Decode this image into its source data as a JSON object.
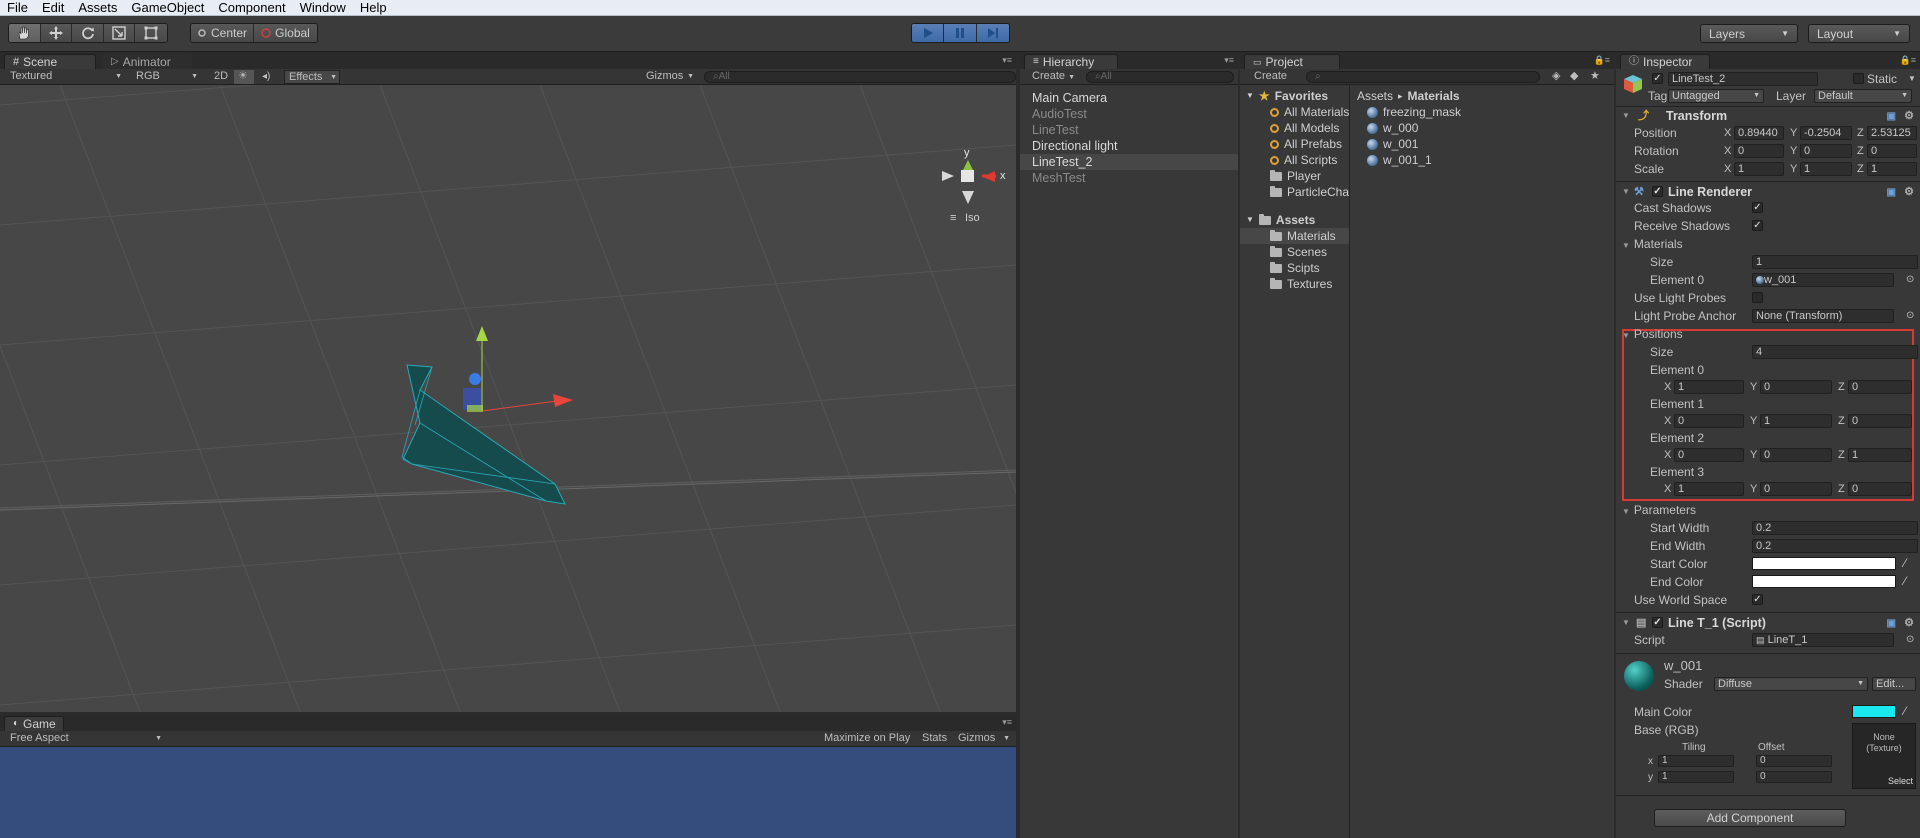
{
  "menu": [
    "File",
    "Edit",
    "Assets",
    "GameObject",
    "Component",
    "Window",
    "Help"
  ],
  "toolbar": {
    "pivot": "Center",
    "space": "Global",
    "layers": "Layers",
    "layout": "Layout"
  },
  "scene": {
    "tabs": [
      "Scene",
      "Animator"
    ],
    "shading": "Textured",
    "render_mode": "RGB",
    "mode_2d": "2D",
    "effects": "Effects",
    "gizmos": "Gizmos",
    "search": "All",
    "gizmo_y": "y",
    "gizmo_x": "x",
    "projection": "Iso"
  },
  "game": {
    "tab": "Game",
    "aspect": "Free Aspect",
    "maximize": "Maximize on Play",
    "stats": "Stats",
    "gizmos": "Gizmos"
  },
  "hierarchy": {
    "tab": "Hierarchy",
    "create": "Create",
    "search": "All",
    "items": [
      {
        "label": "Main Camera",
        "dim": false,
        "selected": false
      },
      {
        "label": "AudioTest",
        "dim": true,
        "selected": false
      },
      {
        "label": "LineTest",
        "dim": true,
        "selected": false
      },
      {
        "label": "Directional light",
        "dim": false,
        "selected": false
      },
      {
        "label": "LineTest_2",
        "dim": false,
        "selected": true
      },
      {
        "label": "MeshTest",
        "dim": true,
        "selected": false
      }
    ]
  },
  "project": {
    "tab": "Project",
    "create": "Create",
    "favorites_label": "Favorites",
    "favorites": [
      "All Materials",
      "All Models",
      "All Prefabs",
      "All Scripts",
      "Player",
      "ParticleCha"
    ],
    "assets_label": "Assets",
    "assets": [
      "Materials",
      "Scenes",
      "Scipts",
      "Textures"
    ],
    "breadcrumb_root": "Assets",
    "breadcrumb_sep": "▸",
    "breadcrumb_current": "Materials",
    "files": [
      "freezing_mask",
      "w_000",
      "w_001",
      "w_001_1"
    ]
  },
  "inspector": {
    "tab": "Inspector",
    "object_name": "LineTest_2",
    "static_label": "Static",
    "tag_label": "Tag",
    "tag_value": "Untagged",
    "layer_label": "Layer",
    "layer_value": "Default",
    "transform": {
      "title": "Transform",
      "position_label": "Position",
      "rotation_label": "Rotation",
      "scale_label": "Scale",
      "position": [
        "0.89440",
        "-0.2504",
        "2.53125"
      ],
      "rotation": [
        "0",
        "0",
        "0"
      ],
      "scale": [
        "1",
        "1",
        "1"
      ]
    },
    "line_renderer": {
      "title": "Line Renderer",
      "cast_shadows": "Cast Shadows",
      "receive_shadows": "Receive Shadows",
      "materials": "Materials",
      "size_label": "Size",
      "materials_size": "1",
      "element0_label": "Element 0",
      "element0_value": "w_001",
      "use_light_probes": "Use Light Probes",
      "light_probe_anchor": "Light Probe Anchor",
      "light_probe_anchor_value": "None (Transform)",
      "positions": "Positions",
      "positions_size": "4",
      "elements": [
        {
          "label": "Element 0",
          "x": "1",
          "y": "0",
          "z": "0"
        },
        {
          "label": "Element 1",
          "x": "0",
          "y": "1",
          "z": "0"
        },
        {
          "label": "Element 2",
          "x": "0",
          "y": "0",
          "z": "1"
        },
        {
          "label": "Element 3",
          "x": "1",
          "y": "0",
          "z": "0"
        }
      ],
      "parameters": "Parameters",
      "start_width_label": "Start Width",
      "start_width": "0.2",
      "end_width_label": "End Width",
      "end_width": "0.2",
      "start_color_label": "Start Color",
      "end_color_label": "End Color",
      "use_world_space": "Use World Space"
    },
    "script_comp": {
      "title": "Line T_1 (Script)",
      "script_label": "Script",
      "script_value": "LineT_1"
    },
    "material": {
      "name": "w_001",
      "shader_label": "Shader",
      "shader_value": "Diffuse",
      "edit": "Edit...",
      "main_color": "Main Color",
      "main_color_hex": "#19e8ef",
      "base_rgb": "Base (RGB)",
      "tiling": "Tiling",
      "offset": "Offset",
      "x_label": "x",
      "y_label": "y",
      "tiling_x": "1",
      "tiling_y": "1",
      "offset_x": "0",
      "offset_y": "0",
      "texture_none": "None",
      "texture_type": "(Texture)",
      "select": "Select"
    },
    "add_component": "Add Component"
  }
}
